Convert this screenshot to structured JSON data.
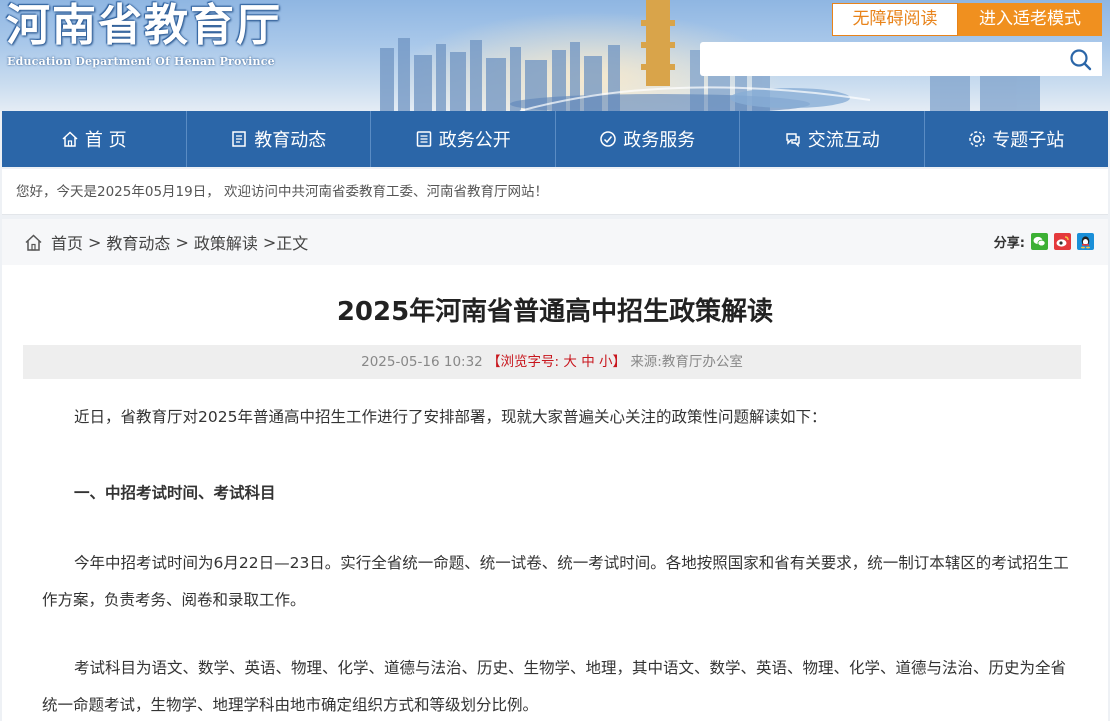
{
  "header": {
    "title": "河南省教育厅",
    "subtitle": "Education Department Of Henan Province",
    "barrier_free_label": "无障碍阅读",
    "elder_mode_label": "进入适老模式",
    "search": {
      "value": "",
      "placeholder": ""
    }
  },
  "nav": {
    "items": [
      {
        "label": "首 页",
        "icon": "home-icon"
      },
      {
        "label": "教育动态",
        "icon": "news-icon"
      },
      {
        "label": "政务公开",
        "icon": "document-icon"
      },
      {
        "label": "政务服务",
        "icon": "service-icon"
      },
      {
        "label": "交流互动",
        "icon": "interaction-icon"
      },
      {
        "label": "专题子站",
        "icon": "topic-icon"
      }
    ]
  },
  "welcome_text": "您好，今天是2025年05月19日， 欢迎访问中共河南省委教育工委、河南省教育厅网站！",
  "breadcrumb": {
    "home": "首页",
    "level1": "教育动态",
    "level2": "政策解读",
    "current": "正文",
    "sep": ">"
  },
  "share": {
    "label": "分享:",
    "icons": [
      "wechat-icon",
      "weibo-icon",
      "qq-icon"
    ]
  },
  "article": {
    "title": "2025年河南省普通高中招生政策解读",
    "date": "2025-05-16 10:32",
    "font_size_label_open": "【浏览字号:",
    "font_large": "大",
    "font_medium": "中",
    "font_small": "小",
    "font_size_label_close": "】",
    "source_label": "来源:",
    "source": "教育厅办公室",
    "paragraph1": "近日，省教育厅对2025年普通高中招生工作进行了安排部署，现就大家普遍关心关注的政策性问题解读如下：",
    "heading1": "一、中招考试时间、考试科目",
    "paragraph2": "今年中招考试时间为6月22日—23日。实行全省统一命题、统一试卷、统一考试时间。各地按照国家和省有关要求，统一制订本辖区的考试招生工作方案，负责考务、阅卷和录取工作。",
    "paragraph3": "考试科目为语文、数学、英语、物理、化学、道德与法治、历史、生物学、地理，其中语文、数学、英语、物理、化学、道德与法治、历史为全省统一命题考试，生物学、地理学科由地市确定组织方式和等级划分比例。"
  },
  "colors": {
    "nav_bg": "#2b66a8",
    "accent_orange": "#f0901f",
    "red": "#c8161d"
  }
}
